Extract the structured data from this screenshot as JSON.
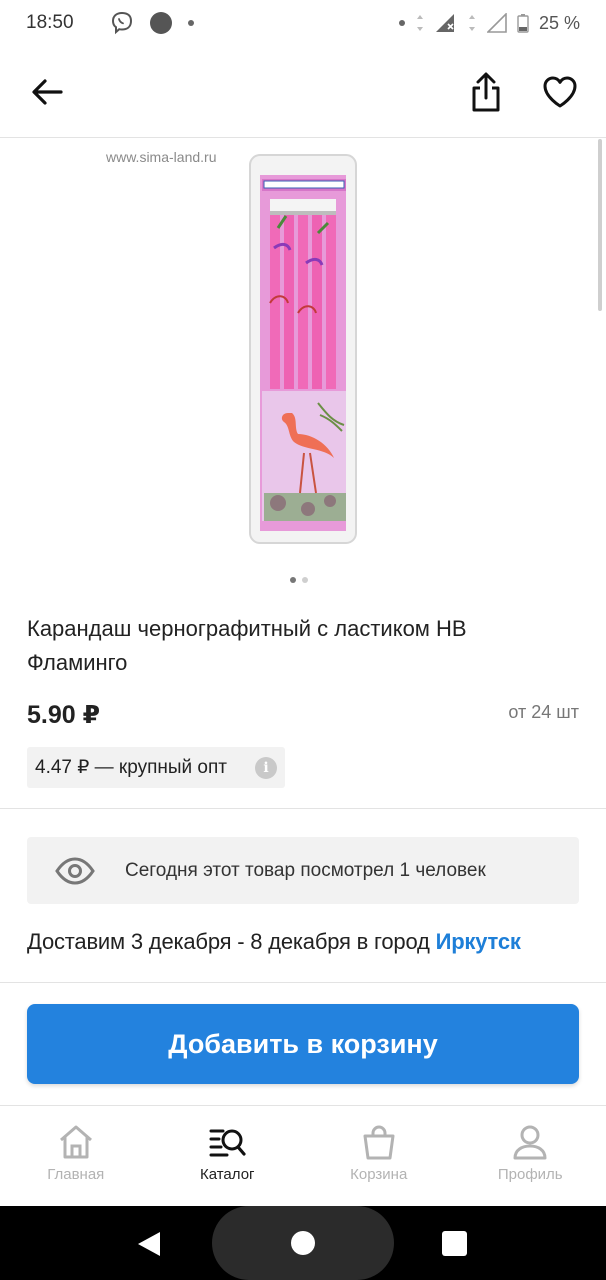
{
  "status_bar": {
    "time": "18:50",
    "battery": "25 %",
    "icons": [
      "viber-icon",
      "notification-dot-icon",
      "signal-icon",
      "battery-icon"
    ]
  },
  "gallery": {
    "watermark": "www.sima-land.ru",
    "pages": 2,
    "active_page": 1
  },
  "product": {
    "title": "Карандаш чернографитный с ластиком HB Фламинго",
    "price": "5.90 ₽",
    "min_qty": "от 24 шт",
    "bulk_price": "4.47 ₽ — крупный опт"
  },
  "viewers_text": "Сегодня этот товар посмотрел 1 человек",
  "delivery": {
    "text": "Доставим 3 декабря - 8 декабря в город ",
    "city": "Иркутск"
  },
  "cart_button": "Добавить в корзину",
  "bottom_nav": {
    "home": "Главная",
    "catalog": "Каталог",
    "cart": "Корзина",
    "profile": "Профиль"
  },
  "colors": {
    "accent": "#2382de",
    "link": "#1e7fd8",
    "inactive": "#b3b3b3"
  }
}
